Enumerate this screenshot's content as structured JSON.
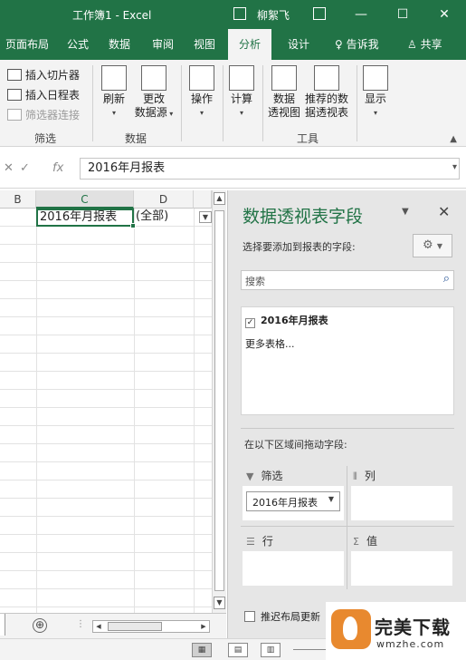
{
  "window": {
    "title": "工作簿1  -  Excel",
    "user": "柳絮飞",
    "controls": {
      "minimize": "—",
      "maximize": "☐",
      "close": "✕"
    }
  },
  "tabs": [
    {
      "label": "页面布局"
    },
    {
      "label": "公式"
    },
    {
      "label": "数据"
    },
    {
      "label": "审阅"
    },
    {
      "label": "视图"
    },
    {
      "label": "分析",
      "active": true
    },
    {
      "label": "设计"
    },
    {
      "label": "告诉我",
      "icon": "lightbulb-icon"
    },
    {
      "label": "共享",
      "icon": "person-icon"
    }
  ],
  "ribbon": {
    "filter_group": {
      "insert_slicer": "插入切片器",
      "insert_timeline": "插入日程表",
      "filter_connections": "筛选器连接",
      "label": "筛选"
    },
    "data_group": {
      "refresh": "刷新",
      "change_source_line1": "更改",
      "change_source_line2": "数据源",
      "label": "数据"
    },
    "actions": "操作",
    "calculations": "计算",
    "tools_group": {
      "pivotchart_line1": "数据",
      "pivotchart_line2": "透视图",
      "recommended_line1": "推荐的数",
      "recommended_line2": "据透视表",
      "label": "工具"
    },
    "show": "显示"
  },
  "formula_bar": {
    "cancel": "✕",
    "enter": "✓",
    "fx": "fx",
    "value": "2016年月报表"
  },
  "grid": {
    "columns": [
      "B",
      "C",
      "D"
    ],
    "selected_column": "C",
    "cell_c1": "2016年月报表",
    "cell_d1": "(全部)"
  },
  "sheetbar": {
    "add_sheet": "⊕",
    "dots": "⋮"
  },
  "pivot_pane": {
    "title": "数据透视表字段",
    "subtitle": "选择要添加到报表的字段:",
    "search_placeholder": "搜索",
    "fields": [
      {
        "label": "2016年月报表",
        "checked": true
      }
    ],
    "more_tables": "更多表格...",
    "drag_label": "在以下区域间拖动字段:",
    "areas": {
      "filters": {
        "label": "筛选",
        "items": [
          "2016年月报表"
        ]
      },
      "columns": {
        "label": "列"
      },
      "rows": {
        "label": "行"
      },
      "values": {
        "label": "值"
      }
    },
    "defer_update": "推迟布局更新"
  },
  "watermark": {
    "text_cn": "完美下载",
    "text_url": "wmzhe.com"
  },
  "colors": {
    "accent": "#217346",
    "pane_title": "#217346"
  }
}
